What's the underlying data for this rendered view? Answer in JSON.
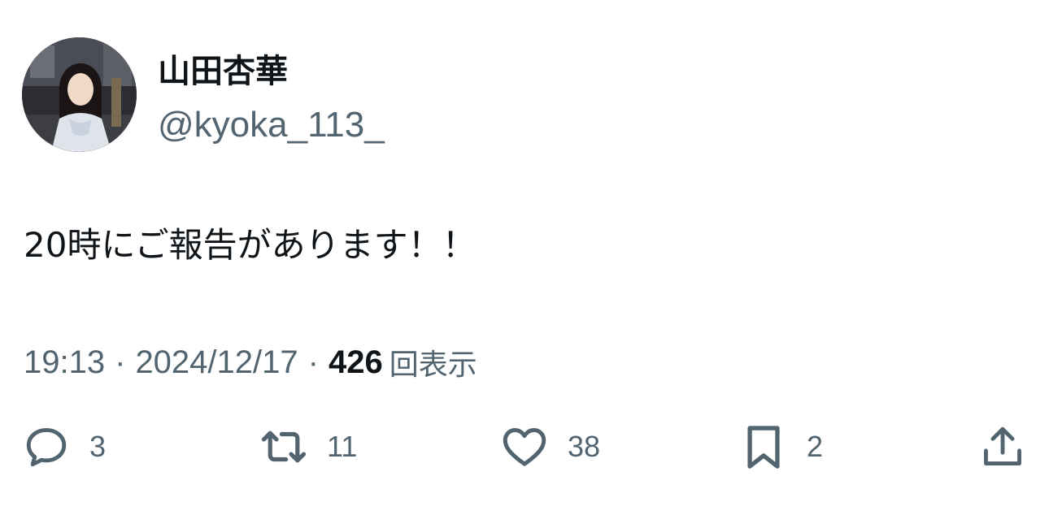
{
  "author": {
    "display_name": "山田杏華",
    "handle": "@kyoka_113_",
    "avatar_icon": "profile-photo"
  },
  "tweet": {
    "text": "20時にご報告があります！！",
    "time": "19:13",
    "separator": "·",
    "date": "2024/12/17",
    "views_count": "426",
    "views_label": "回表示"
  },
  "actions": {
    "reply": {
      "icon": "reply-icon",
      "count": "3"
    },
    "retweet": {
      "icon": "retweet-icon",
      "count": "11"
    },
    "like": {
      "icon": "heart-icon",
      "count": "38"
    },
    "bookmark": {
      "icon": "bookmark-icon",
      "count": "2"
    },
    "share": {
      "icon": "share-icon"
    }
  },
  "colors": {
    "primary_text": "#0f1419",
    "secondary_text": "#536471",
    "background": "#ffffff"
  }
}
